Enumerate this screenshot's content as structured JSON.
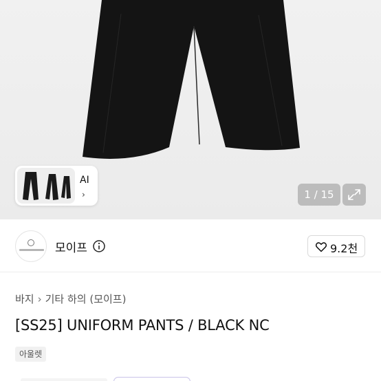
{
  "gallery": {
    "counter": "1 / 15",
    "thumbnail_label": "AI",
    "thumbnail_chevron": "›"
  },
  "seller": {
    "name": "모이프"
  },
  "like": {
    "count": "9.2천"
  },
  "breadcrumb": {
    "items": [
      "바지",
      "기타 하의 (모이프)"
    ],
    "separator": "›"
  },
  "product": {
    "title": "[SS25] UNIFORM PANTS / BLACK NC",
    "tag": "아울렛"
  },
  "icons": {
    "info": "info-icon",
    "heart": "heart-outline-icon",
    "expand": "expand-icon",
    "chevron": "chevron-right-icon"
  }
}
